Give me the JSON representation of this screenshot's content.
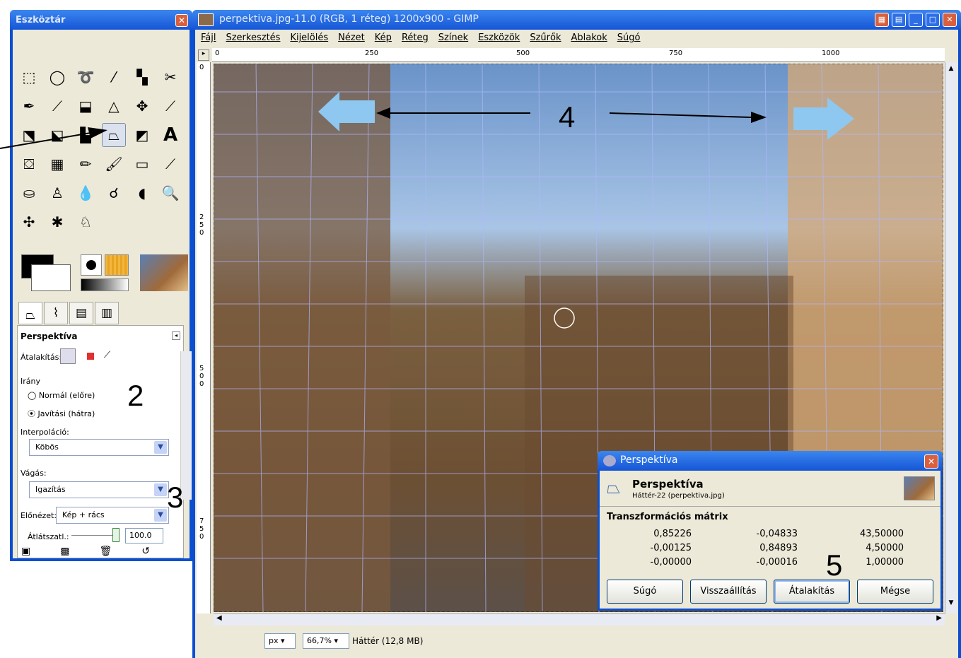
{
  "toolbox": {
    "title": "Eszköztár",
    "tools": [
      "rect-select",
      "ellipse-select",
      "free-select",
      "fuzzy-select",
      "color-select",
      "scissors",
      "paths",
      "color-picker",
      "zoom-select",
      "measure",
      "move",
      "align",
      "crop",
      "rotate",
      "scale",
      "shear",
      "perspective",
      "flip",
      "text",
      "bucket",
      "blend",
      "pencil",
      "paintbrush",
      "eraser",
      "airbrush",
      "ink",
      "clone",
      "heal",
      "dodge",
      "smudge",
      "burn",
      "magnify",
      "cage",
      "heal2",
      "perspective-clone"
    ],
    "options": {
      "title": "Perspektíva",
      "transform_label": "Átalakítás:",
      "direction_label": "Irány",
      "dir_normal": "Normál (előre)",
      "dir_correct": "Javítási (hátra)",
      "interp_label": "Interpoláció:",
      "interp_value": "Köbös",
      "clip_label": "Vágás:",
      "clip_value": "Igazítás",
      "preview_label": "Előnézet:",
      "preview_value": "Kép + rács",
      "opacity_label": "Átlátszatl.:",
      "opacity_value": "100.0"
    }
  },
  "image_window": {
    "title": "perpektiva.jpg-11.0 (RGB, 1 réteg) 1200x900 - GIMP",
    "menu": [
      "Fájl",
      "Szerkesztés",
      "Kijelölés",
      "Nézet",
      "Kép",
      "Réteg",
      "Színek",
      "Eszközök",
      "Szűrők",
      "Ablakok",
      "Súgó"
    ],
    "ruler_h": [
      "0",
      "250",
      "500",
      "750",
      "1000"
    ],
    "ruler_v": [
      "0",
      "250",
      "500",
      "750"
    ],
    "status": {
      "unit": "px",
      "zoom": "66,7%",
      "layer": "Háttér (12,8 MB)"
    }
  },
  "dialog": {
    "title": "Perspektíva",
    "heading": "Perspektíva",
    "sub": "Háttér-22 (perpektiva.jpg)",
    "matrix_label": "Transzformációs mátrix",
    "matrix": [
      [
        "0,85226",
        "-0,04833",
        "43,50000"
      ],
      [
        "-0,00125",
        "0,84893",
        "4,50000"
      ],
      [
        "-0,00000",
        "-0,00016",
        "1,00000"
      ]
    ],
    "buttons": {
      "help": "Súgó",
      "reset": "Visszaállítás",
      "transform": "Átalakítás",
      "cancel": "Mégse"
    }
  },
  "annotations": {
    "n2": "2",
    "n3": "3",
    "n4": "4",
    "n5": "5"
  },
  "colors": {
    "titlebar": "#0a4fd1",
    "arrow_fill": "#8ec8f0"
  }
}
